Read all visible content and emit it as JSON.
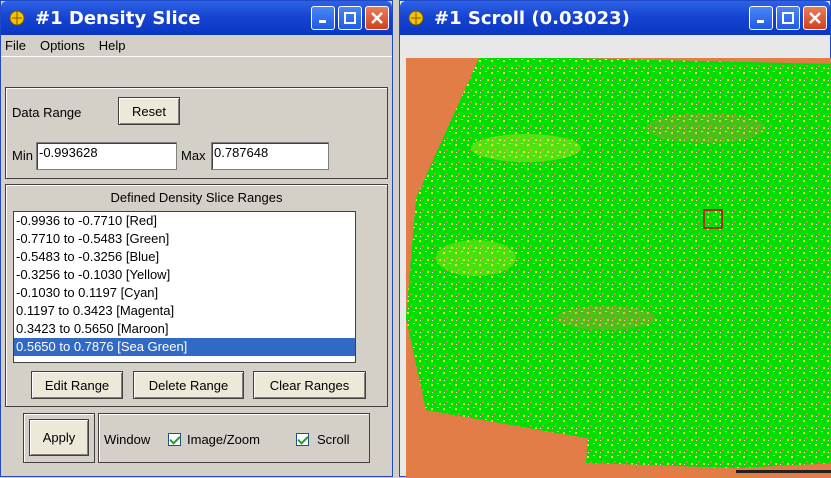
{
  "density_window": {
    "title": "#1 Density Slice",
    "menu": [
      "File",
      "Options",
      "Help"
    ],
    "data_range": {
      "label": "Data Range",
      "reset_label": "Reset",
      "min_label": "Min",
      "min_value": "-0.993628",
      "max_label": "Max",
      "max_value": "0.787648"
    },
    "ranges": {
      "heading": "Defined Density Slice Ranges",
      "items": [
        "-0.9936 to -0.7710 [Red]",
        "-0.7710 to -0.5483 [Green]",
        "-0.5483 to -0.3256 [Blue]",
        "-0.3256 to -0.1030 [Yellow]",
        "-0.1030 to 0.1197 [Cyan]",
        "0.1197 to 0.3423 [Magenta]",
        "0.3423 to 0.5650 [Maroon]",
        "0.5650 to 0.7876 [Sea Green]"
      ],
      "selected_index": 7,
      "edit_label": "Edit Range",
      "delete_label": "Delete Range",
      "clear_label": "Clear Ranges"
    },
    "apply_label": "Apply",
    "window_label": "Window",
    "image_zoom_label": "Image/Zoom",
    "image_zoom_checked": true,
    "scroll_label": "Scroll",
    "scroll_checked": true
  },
  "scroll_window": {
    "title": "#1 Scroll (0.03023)",
    "background_color": "#e27d48",
    "image_colors": [
      "#00e000",
      "#e8e82a",
      "#e27d48"
    ]
  }
}
